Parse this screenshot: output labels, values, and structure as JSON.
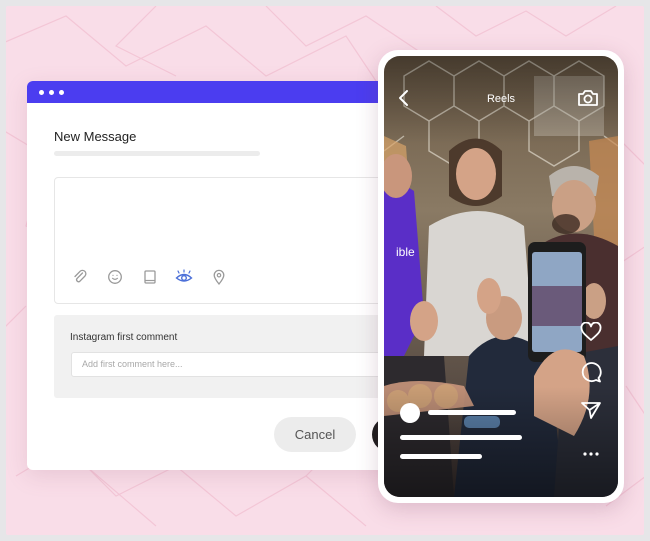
{
  "composer": {
    "title": "New Message",
    "toolbar_icons": [
      "paperclip-icon",
      "emoji-icon",
      "book-icon",
      "eye-icon",
      "location-pin-icon"
    ],
    "first_comment": {
      "label": "Instagram first comment",
      "placeholder": "Add first comment here..."
    },
    "cancel_label": "Cancel"
  },
  "phone": {
    "header_title": "Reels",
    "icons": [
      "back-chevron-icon",
      "camera-icon",
      "heart-icon",
      "comment-icon",
      "share-icon",
      "more-icon"
    ],
    "hoodie_text": "ible"
  },
  "colors": {
    "accent": "#4b3df0",
    "background": "#f9dde8"
  }
}
